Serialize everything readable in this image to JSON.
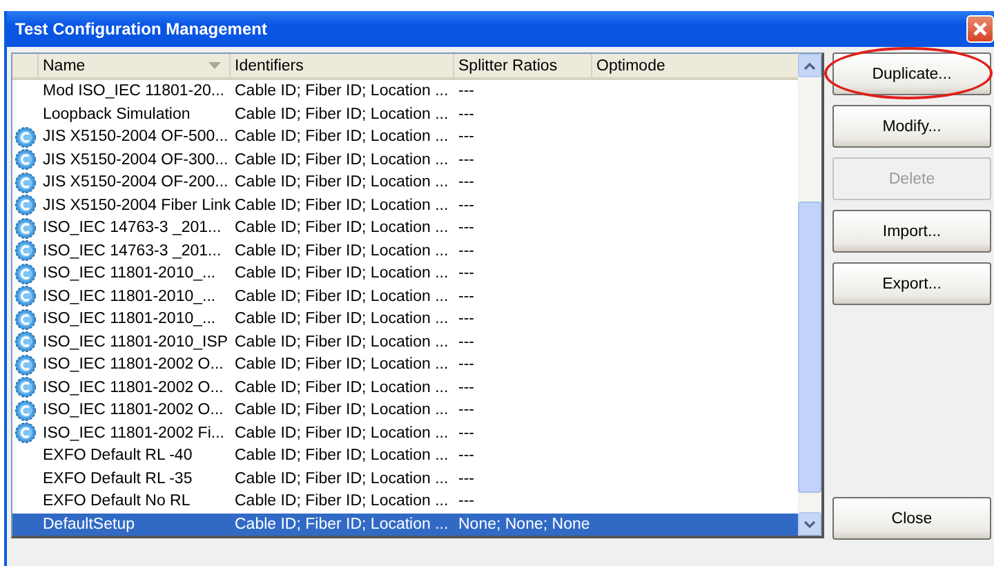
{
  "window": {
    "title": "Test Configuration Management"
  },
  "table": {
    "columns": [
      "Name",
      "Identifiers",
      "Splitter Ratios",
      "Optimode"
    ],
    "rows": [
      {
        "icon": false,
        "selected": false,
        "cells": [
          "Mod ISO_IEC 11801-20...",
          "Cable ID; Fiber ID; Location ...",
          "---"
        ]
      },
      {
        "icon": false,
        "selected": false,
        "cells": [
          "Loopback Simulation",
          "Cable ID; Fiber ID; Location ...",
          "---"
        ]
      },
      {
        "icon": true,
        "selected": false,
        "cells": [
          "JIS X5150-2004 OF-500...",
          "Cable ID; Fiber ID; Location ...",
          "---"
        ]
      },
      {
        "icon": true,
        "selected": false,
        "cells": [
          "JIS X5150-2004 OF-300...",
          "Cable ID; Fiber ID; Location ...",
          "---"
        ]
      },
      {
        "icon": true,
        "selected": false,
        "cells": [
          "JIS X5150-2004 OF-200...",
          "Cable ID; Fiber ID; Location ...",
          "---"
        ]
      },
      {
        "icon": true,
        "selected": false,
        "cells": [
          "JIS X5150-2004 Fiber Link",
          "Cable ID; Fiber ID; Location ...",
          "---"
        ]
      },
      {
        "icon": true,
        "selected": false,
        "cells": [
          "ISO_IEC 14763-3 _201...",
          "Cable ID; Fiber ID; Location ...",
          "---"
        ]
      },
      {
        "icon": true,
        "selected": false,
        "cells": [
          "ISO_IEC 14763-3 _201...",
          "Cable ID; Fiber ID; Location ...",
          "---"
        ]
      },
      {
        "icon": true,
        "selected": false,
        "cells": [
          "ISO_IEC 11801-2010_...",
          "Cable ID; Fiber ID; Location ...",
          "---"
        ]
      },
      {
        "icon": true,
        "selected": false,
        "cells": [
          "ISO_IEC 11801-2010_...",
          "Cable ID; Fiber ID; Location ...",
          "---"
        ]
      },
      {
        "icon": true,
        "selected": false,
        "cells": [
          "ISO_IEC 11801-2010_...",
          "Cable ID; Fiber ID; Location ...",
          "---"
        ]
      },
      {
        "icon": true,
        "selected": false,
        "cells": [
          "ISO_IEC 11801-2010_ISP",
          "Cable ID; Fiber ID; Location ...",
          "---"
        ]
      },
      {
        "icon": true,
        "selected": false,
        "cells": [
          "ISO_IEC 11801-2002 O...",
          "Cable ID; Fiber ID; Location ...",
          "---"
        ]
      },
      {
        "icon": true,
        "selected": false,
        "cells": [
          "ISO_IEC 11801-2002 O...",
          "Cable ID; Fiber ID; Location ...",
          "---"
        ]
      },
      {
        "icon": true,
        "selected": false,
        "cells": [
          "ISO_IEC 11801-2002 O...",
          "Cable ID; Fiber ID; Location ...",
          "---"
        ]
      },
      {
        "icon": true,
        "selected": false,
        "cells": [
          "ISO_IEC 11801-2002 Fi...",
          "Cable ID; Fiber ID; Location ...",
          "---"
        ]
      },
      {
        "icon": false,
        "selected": false,
        "cells": [
          "EXFO Default RL -40",
          "Cable ID; Fiber ID; Location ...",
          "---"
        ]
      },
      {
        "icon": false,
        "selected": false,
        "cells": [
          "EXFO Default RL -35",
          "Cable ID; Fiber ID; Location ...",
          "---"
        ]
      },
      {
        "icon": false,
        "selected": false,
        "cells": [
          "EXFO Default No RL",
          "Cable ID; Fiber ID; Location ...",
          "---"
        ]
      },
      {
        "icon": false,
        "selected": true,
        "cells": [
          "DefaultSetup",
          "Cable ID; Fiber ID; Location ...",
          "None; None; None"
        ]
      }
    ]
  },
  "buttons": [
    {
      "label": "Duplicate...",
      "disabled": false,
      "circled": true
    },
    {
      "label": "Modify...",
      "disabled": false,
      "circled": false
    },
    {
      "label": "Delete",
      "disabled": true,
      "circled": false
    },
    {
      "label": "Import...",
      "disabled": false,
      "circled": false
    },
    {
      "label": "Export...",
      "disabled": false,
      "circled": false
    }
  ],
  "close_button": "Close"
}
